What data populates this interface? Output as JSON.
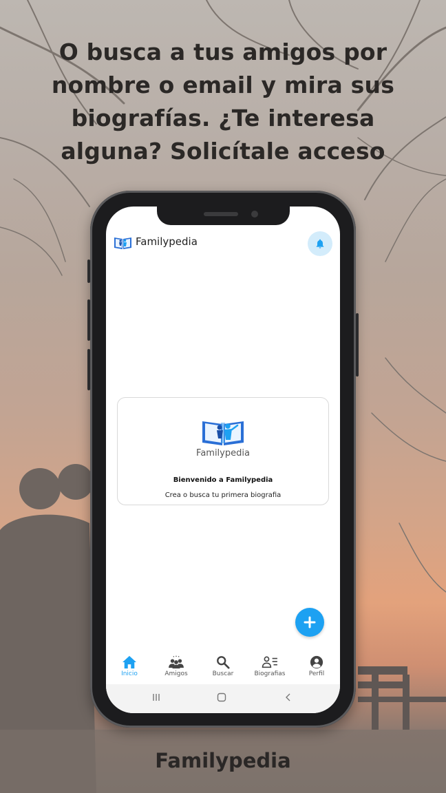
{
  "promo": {
    "headline_line1": "O busca a tus amigos por",
    "headline_line2": "nombre o email y mira sus",
    "headline_line3": "biografías. ¿Te interesa",
    "headline_line4": "alguna? Solicítale acceso",
    "footer_brand": "Familypedia"
  },
  "app": {
    "name": "Familypedia",
    "accent_color": "#1da1f2",
    "bell_bg_color": "#d3ecfb",
    "icons": {
      "logo": "book-family-logo-icon",
      "notifications": "bell-icon",
      "add": "plus-icon"
    }
  },
  "welcome_card": {
    "brand": "Familypedia",
    "title": "Bienvenido a Familypedia",
    "subtitle": "Crea o busca tu primera biografia"
  },
  "bottom_nav": {
    "items": [
      {
        "label": "Inicio",
        "icon": "home-icon",
        "active": true
      },
      {
        "label": "Amigos",
        "icon": "group-icon",
        "active": false
      },
      {
        "label": "Buscar",
        "icon": "search-icon",
        "active": false
      },
      {
        "label": "Biografias",
        "icon": "person-list-icon",
        "active": false
      },
      {
        "label": "Perfil",
        "icon": "account-circle-icon",
        "active": false
      }
    ]
  },
  "system_nav": {
    "icons": [
      "recent-apps-icon",
      "home-circle-icon",
      "back-icon"
    ]
  }
}
